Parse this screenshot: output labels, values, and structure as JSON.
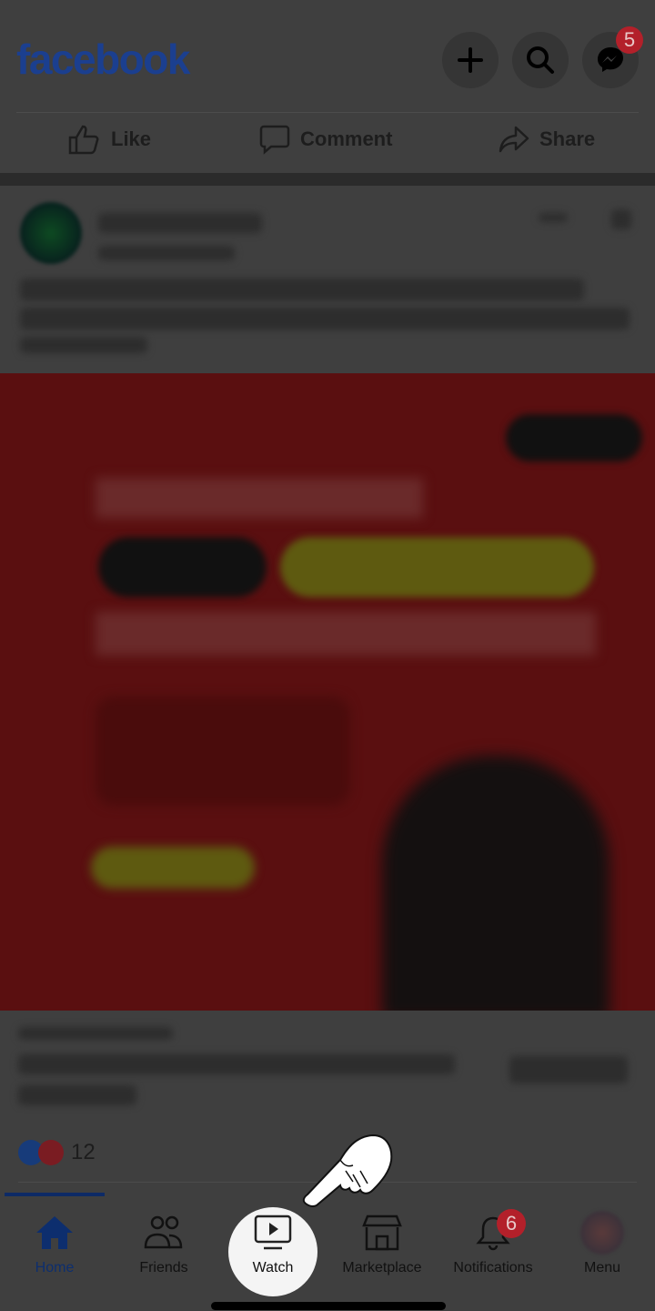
{
  "header": {
    "logo": "facebook",
    "messenger_badge": "5",
    "icons": [
      "plus-icon",
      "search-icon",
      "messenger-icon"
    ]
  },
  "actions": [
    {
      "label": "Like",
      "icon": "thumbs-up-icon"
    },
    {
      "label": "Comment",
      "icon": "comment-icon"
    },
    {
      "label": "Share",
      "icon": "share-icon"
    }
  ],
  "post": {
    "reaction_count": "12",
    "image_color": "#5a0f10"
  },
  "nav": {
    "tabs": [
      {
        "label": "Home",
        "icon": "home-icon",
        "active": true
      },
      {
        "label": "Friends",
        "icon": "friends-icon"
      },
      {
        "label": "Watch",
        "icon": "watch-icon",
        "highlighted": true
      },
      {
        "label": "Marketplace",
        "icon": "marketplace-icon"
      },
      {
        "label": "Notifications",
        "icon": "bell-icon",
        "badge": "6"
      },
      {
        "label": "Menu",
        "icon": "avatar"
      }
    ]
  },
  "colors": {
    "accent": "#1b3f8f",
    "badge": "#b3202a"
  }
}
